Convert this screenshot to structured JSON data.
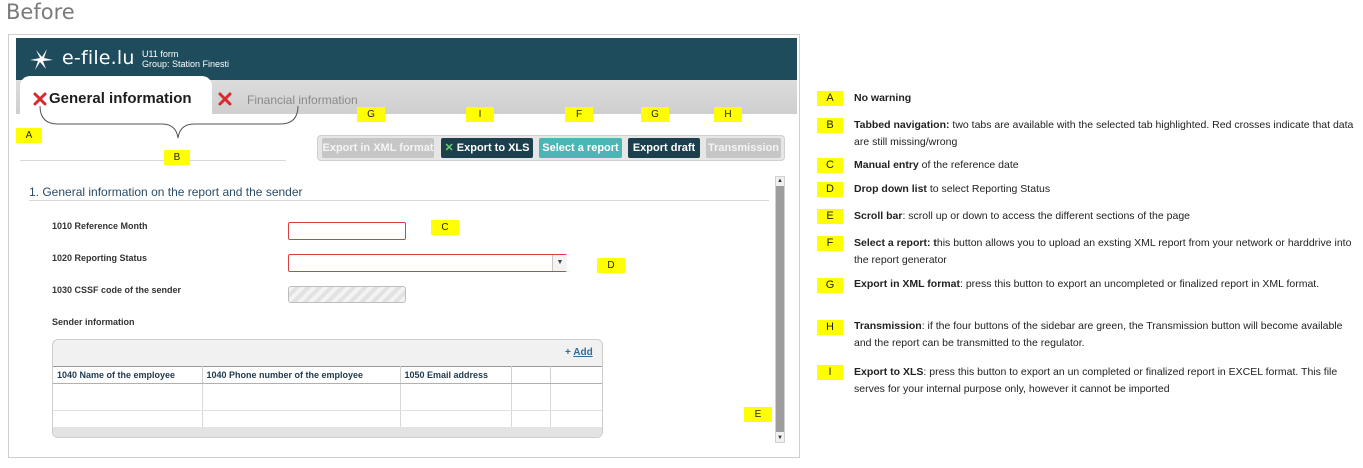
{
  "heading": "Before",
  "app": {
    "logo_text": "e-file.lu",
    "form_name": "U11 form",
    "group": "Group: Station Finesti"
  },
  "tabs": [
    {
      "label": "General information",
      "active": true,
      "status": "missing-data"
    },
    {
      "label": "Financial information",
      "active": false,
      "status": "missing-data"
    }
  ],
  "toolbar": {
    "export_xml": "Export in XML format",
    "export_xls": "Export to XLS",
    "select_report": "Select a report",
    "export_draft": "Export draft",
    "transmission": "Transmission"
  },
  "section": {
    "title": "1. General information on the report and the sender",
    "fields": {
      "reference_month": "1010 Reference Month",
      "reporting_status": "1020 Reporting Status",
      "cssf_code": "1030 CSSF code of the sender",
      "sender_info": "Sender information"
    },
    "table": {
      "add_label": "Add",
      "columns": [
        "1040 Name of the employee",
        "1040 Phone number of the employee",
        "1050 Email address",
        "",
        ""
      ]
    }
  },
  "markers": {
    "A": "A",
    "B": "B",
    "C": "C",
    "D": "D",
    "E": "E",
    "F": "F",
    "G": "G",
    "H": "H",
    "I": "I"
  },
  "legend": [
    {
      "key": "A",
      "bold": "No warning",
      "text": ""
    },
    {
      "key": "B",
      "bold": "Tabbed navigation:",
      "text": " two tabs are available with the selected tab highlighted. Red crosses indicate that data are still missing/wrong"
    },
    {
      "key": "C",
      "bold": "Manual entry",
      "text": " of the reference date"
    },
    {
      "key": "D",
      "bold": "Drop down list",
      "text": " to select Reporting Status"
    },
    {
      "key": "E",
      "bold": "Scroll bar",
      "text": ": scroll up or down to access the different sections of the page"
    },
    {
      "key": "F",
      "bold": "Select a report: t",
      "text": "his button allows you to upload an exsting XML report from your network or harddrive into the report generator"
    },
    {
      "key": "G",
      "bold": "Export in XML format",
      "text": ": press this button to export an uncompleted or finalized report in XML format."
    },
    {
      "key": "H",
      "bold": "Transmission",
      "text": ": if the four buttons of the sidebar are green, the Transmission button will become available and the report can be transmitted to the regulator."
    },
    {
      "key": "I",
      "bold": "Export to XLS",
      "text": ": press this button to export an un completed or finalized report in EXCEL format. This file serves for your internal purpose only, however it cannot be imported"
    }
  ],
  "colors": {
    "header_bg": "#1e4c5c",
    "marker": "#ffff00",
    "error_border": "#d8403f",
    "button_teal": "#4cb6b6",
    "button_dark": "#1b3f4c"
  }
}
